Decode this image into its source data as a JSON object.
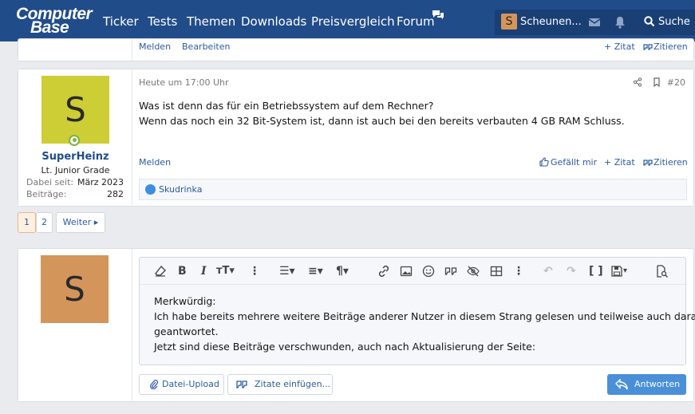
{
  "nav": {
    "logo_line1": "Computer",
    "logo_line2": "Base",
    "items": [
      "Ticker",
      "Tests",
      "Themen",
      "Downloads",
      "Preisvergleich",
      "Forum"
    ],
    "user_initial": "S",
    "user_name": "Scheunen...",
    "search_label": "Suche",
    "colors": {
      "bar": "#214c8a",
      "bar_dark": "#1a3f75"
    }
  },
  "prev_post": {
    "melden": "Melden",
    "bearbeiten": "Bearbeiten",
    "zitat": "+ Zitat",
    "zitieren": "Zitieren"
  },
  "post": {
    "date": "Heute um 17:00 Uhr",
    "number": "#20",
    "author": {
      "initial": "S",
      "avatar_color": "#cdcd35",
      "name": "SuperHeinz",
      "rank": "Lt. Junior Grade",
      "joined_label": "Dabei seit:",
      "joined_value": "März 2023",
      "posts_label": "Beiträge:",
      "posts_value": "282"
    },
    "lines": [
      "Was ist denn das für ein Betriebssystem auf dem Rechner?",
      "Wenn das noch ein 32 Bit-System ist, dann ist auch bei den bereits verbauten 4 GB RAM Schluss."
    ],
    "melden": "Melden",
    "like": "Gefällt mir",
    "zitat": "+ Zitat",
    "zitieren": "Zitieren",
    "reaction_user": "Skudrinka"
  },
  "pagination": {
    "pages": [
      "1",
      "2"
    ],
    "current": "1",
    "next": "Weiter ▸"
  },
  "reply": {
    "avatar_initial": "S",
    "avatar_color": "#d4955b",
    "text_lines": [
      "Merkwürdig:",
      "Ich habe bereits mehrere weitere Beiträge anderer Nutzer in diesem Strang gelesen und teilweise auch darau",
      "geantwortet.",
      "Jetzt sind diese Beiträge verschwunden, auch nach Aktualisierung der Seite:"
    ],
    "upload_label": "Datei-Upload",
    "quotes_label": "Zitate einfügen...",
    "submit_label": "Antworten"
  }
}
